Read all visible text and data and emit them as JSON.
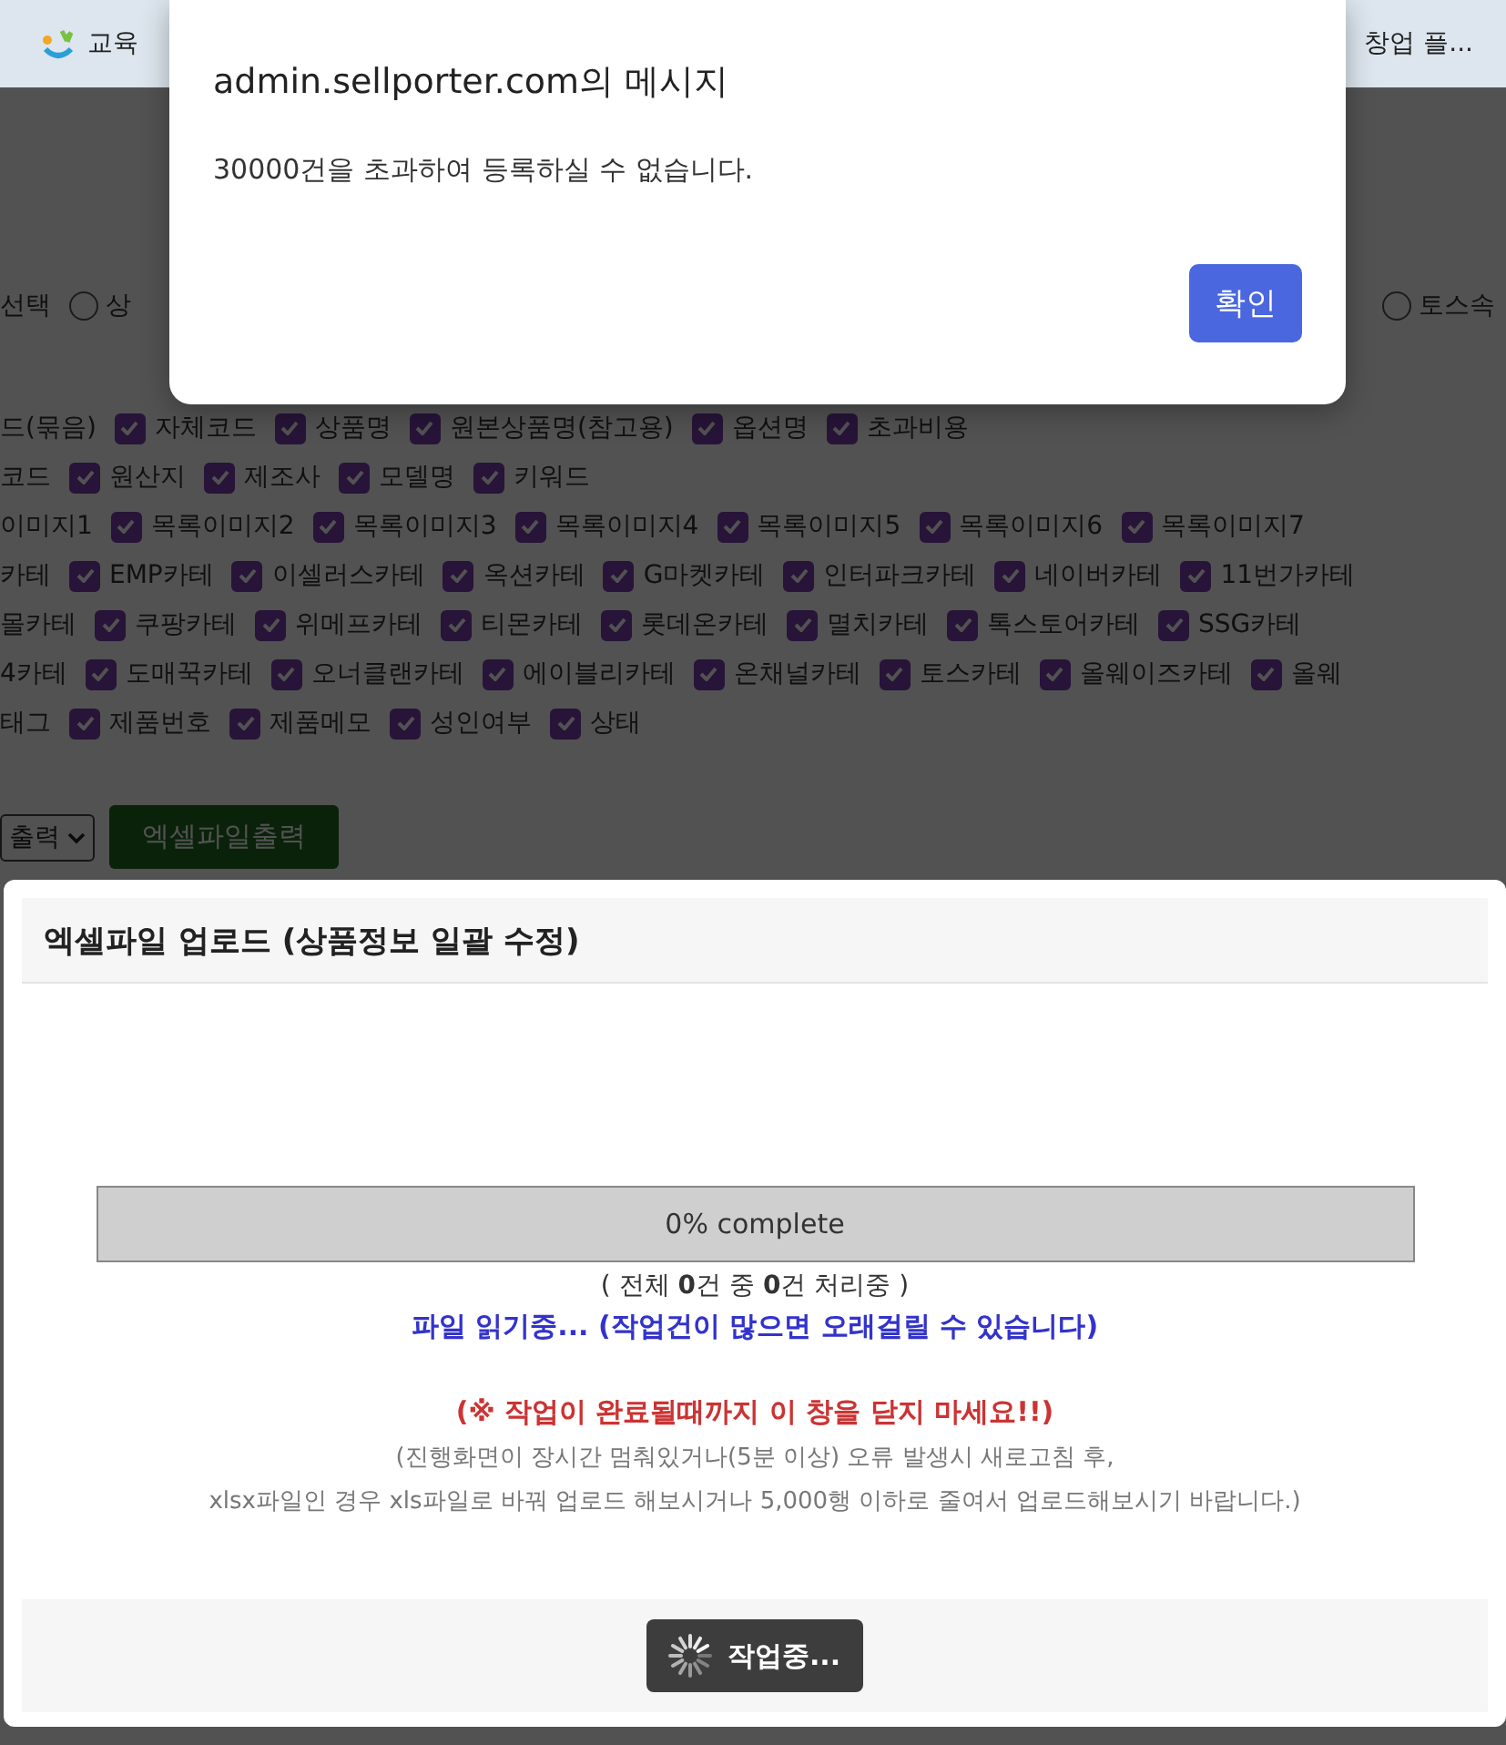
{
  "bookmarks": [
    {
      "label": "교육",
      "icon": true
    },
    {
      "label": "창업 플...",
      "icon": false
    }
  ],
  "background": {
    "radio_row": {
      "label": "선택",
      "options": [
        {
          "label": "상",
          "selected": false
        },
        {
          "label": "토스속",
          "selected": false
        }
      ]
    },
    "field_rows": [
      {
        "prefix": "드(묶음)",
        "fields": [
          {
            "label": "자체코드",
            "checked": true
          },
          {
            "label": "상품명",
            "checked": true
          },
          {
            "label": "원본상품명(참고용)",
            "checked": true
          },
          {
            "label": "옵션명",
            "checked": true
          },
          {
            "label": "초과비용",
            "checked": true
          }
        ]
      },
      {
        "prefix": "코드",
        "fields": [
          {
            "label": "원산지",
            "checked": true
          },
          {
            "label": "제조사",
            "checked": true
          },
          {
            "label": "모델명",
            "checked": true
          },
          {
            "label": "키워드",
            "checked": true
          }
        ]
      },
      {
        "prefix": "이미지1",
        "fields": [
          {
            "label": "목록이미지2",
            "checked": true
          },
          {
            "label": "목록이미지3",
            "checked": true
          },
          {
            "label": "목록이미지4",
            "checked": true
          },
          {
            "label": "목록이미지5",
            "checked": true
          },
          {
            "label": "목록이미지6",
            "checked": true
          },
          {
            "label": "목록이미지7",
            "checked": true
          }
        ]
      },
      {
        "prefix": "카테",
        "fields": [
          {
            "label": "EMP카테",
            "checked": true
          },
          {
            "label": "이셀러스카테",
            "checked": true
          },
          {
            "label": "옥션카테",
            "checked": true
          },
          {
            "label": "G마켓카테",
            "checked": true
          },
          {
            "label": "인터파크카테",
            "checked": true
          },
          {
            "label": "네이버카테",
            "checked": true
          },
          {
            "label": "11번가카테",
            "checked": true
          }
        ]
      },
      {
        "prefix": "몰카테",
        "fields": [
          {
            "label": "쿠팡카테",
            "checked": true
          },
          {
            "label": "위메프카테",
            "checked": true
          },
          {
            "label": "티몬카테",
            "checked": true
          },
          {
            "label": "롯데온카테",
            "checked": true
          },
          {
            "label": "멸치카테",
            "checked": true
          },
          {
            "label": "톡스토어카테",
            "checked": true
          },
          {
            "label": "SSG카테",
            "checked": true
          }
        ]
      },
      {
        "prefix": "4카테",
        "fields": [
          {
            "label": "도매꾹카테",
            "checked": true
          },
          {
            "label": "오너클랜카테",
            "checked": true
          },
          {
            "label": "에이블리카테",
            "checked": true
          },
          {
            "label": "온채널카테",
            "checked": true
          },
          {
            "label": "토스카테",
            "checked": true
          },
          {
            "label": "올웨이즈카테",
            "checked": true
          },
          {
            "label": "올웨",
            "checked": true
          }
        ]
      },
      {
        "prefix": "태그",
        "fields": [
          {
            "label": "제품번호",
            "checked": true
          },
          {
            "label": "제품메모",
            "checked": true
          },
          {
            "label": "성인여부",
            "checked": true
          },
          {
            "label": "상태",
            "checked": true
          }
        ]
      }
    ],
    "export": {
      "select": "출력",
      "button": "엑셀파일출력"
    }
  },
  "upload_modal": {
    "title": "엑셀파일 업로드 (상품정보 일괄 수정)",
    "progress": {
      "level": 0,
      "label": "0% complete"
    },
    "count_text": "( 전체 **0**건 중 **0**건 처리중 )",
    "status": "파일 읽기중... (작업건이 많으면 오래걸릴 수 있습니다)",
    "warning": "(※ 작업이 완료될때까지 이 창을 닫지 마세요!!)",
    "notes": [
      "(진행화면이 장시간 멈춰있거나(5분 이상) 오류 발생시 새로고침 후,",
      "xlsx파일인 경우 xls파일로 바꿔 업로드 해보시거나 5,000행 이하로 줄여서 업로드해보시기 바랍니다.)"
    ],
    "button": "작업중..."
  },
  "alert": {
    "title": "admin.sellporter.com의 메시지",
    "message": "30000건을 초과하여 등록하실 수 없습니다.",
    "button": "확인"
  }
}
